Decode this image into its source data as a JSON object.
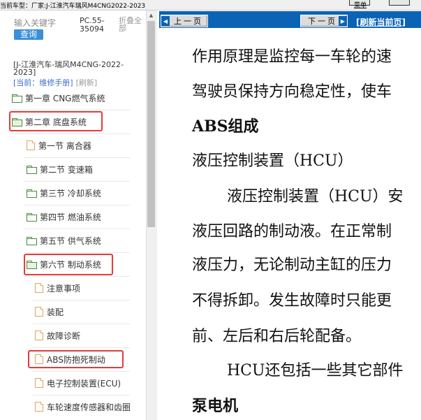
{
  "topbar": {
    "text": "当前车型：厂家:J-江淮汽车瑞风M4CNG2022-2023",
    "link": "菜单"
  },
  "sidebar": {
    "search_placeholder": "输入关键字",
    "search_button": "查询",
    "pc_code": "PC.55-35094",
    "collapse_all": "折叠全部",
    "book_title": "[J-江淮汽车-瑞风M4CNG-2022-2023]",
    "current_label": "[当前：维修手册]",
    "refresh_label": "[刷新]",
    "items": [
      {
        "label": "第一章 CNG燃气系统",
        "icon": "folder-icon"
      },
      {
        "label": "第二章 底盘系统",
        "icon": "folder-open-icon"
      },
      {
        "label": "第一节 离合器",
        "icon": "document-icon"
      },
      {
        "label": "第二节 变速箱",
        "icon": "folder-icon"
      },
      {
        "label": "第三节 冷却系统",
        "icon": "folder-icon"
      },
      {
        "label": "第四节 燃油系统",
        "icon": "folder-icon"
      },
      {
        "label": "第五节 供气系统",
        "icon": "folder-icon"
      },
      {
        "label": "第六节 制动系统",
        "icon": "folder-open-icon"
      },
      {
        "label": "注意事项",
        "icon": "document-icon"
      },
      {
        "label": "装配",
        "icon": "document-icon"
      },
      {
        "label": "故障诊断",
        "icon": "document-icon"
      },
      {
        "label": "ABS防抱死制动",
        "icon": "document-icon"
      },
      {
        "label": "电子控制装置(ECU)",
        "icon": "document-icon"
      },
      {
        "label": "车轮速度传感器和齿圈",
        "icon": "document-icon"
      }
    ]
  },
  "toolbar": {
    "prev_label": "上一页",
    "next_label": "下一页",
    "refresh_label": "[刷新当前页]"
  },
  "document": {
    "lines": [
      "作用原理是监控每一车轮的速",
      "驾驶员保持方向稳定性，使车",
      "ABS组成",
      "液压控制装置（HCU）",
      "液压控制装置（HCU）安",
      "液压回路的制动液。在正常制",
      "液压力，无论制动主缸的压力",
      "不得拆卸。发生故障时只能更",
      "前、左后和右后轮配备。",
      "HCU还包括一些其它部件",
      "泵电机"
    ]
  },
  "colors": {
    "accent": "#0b63b6",
    "highlight": "#e33c3c",
    "search_button": "#3b8fd8"
  }
}
